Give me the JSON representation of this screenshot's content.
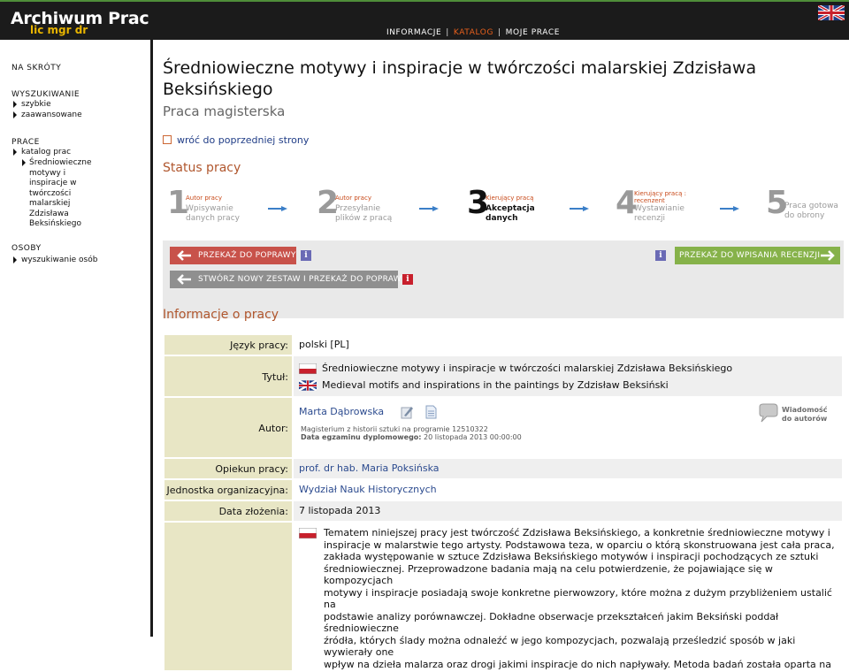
{
  "header": {
    "logo": "Archiwum Prac",
    "logo_sub": "lic mgr dr",
    "nav": [
      "INFORMACJE",
      "KATALOG",
      "MOJE PRACE"
    ],
    "nav_sep": "|",
    "active_nav": "KATALOG",
    "language_icon": "uk-flag-icon"
  },
  "sidebar": {
    "shortcuts": "NA SKRÓTY",
    "search": "WYSZUKIWANIE",
    "search_items": [
      "szybkie",
      "zaawansowane"
    ],
    "works": "PRACE",
    "works_items": [
      "katalog prac"
    ],
    "current_work_lines": [
      "Średniowieczne",
      "motywy i",
      "inspiracje w",
      "twórczości",
      "malarskiej",
      "Zdzisława",
      "Beksińskiego"
    ],
    "people": "OSOBY",
    "people_items": [
      "wyszukiwanie osób"
    ]
  },
  "work": {
    "title_line1": "Średniowieczne motywy i inspiracje w twórczości malarskiej Zdzisława",
    "title_line2": "Beksińskiego",
    "subtitle": "Praca magisterska",
    "back_link": "wróć do poprzedniej strony"
  },
  "status": {
    "heading": "Status pracy",
    "steps": [
      {
        "num": "1",
        "role": "Autor pracy",
        "line1": "Wpisywanie",
        "line2": "danych pracy",
        "active": false
      },
      {
        "num": "2",
        "role": "Autor pracy",
        "line1": "Przesyłanie",
        "line2": "plików z pracą",
        "active": false
      },
      {
        "num": "3",
        "role": "Kierujący pracą",
        "line1": "Akceptacja",
        "line2": "danych",
        "active": true
      },
      {
        "num": "4",
        "role": "Kierujący pracą :",
        "role2": "recenzent",
        "line1": "Wystawianie",
        "line2": "recenzji",
        "active": false
      },
      {
        "num": "5",
        "role": "",
        "line1": "Praca gotowa",
        "line2": "do obrony",
        "active": false
      }
    ],
    "btn_return": "PRZEKAŻ DO POPRAWY",
    "btn_review": "PRZEKAŻ DO WPISANIA RECENZJI",
    "btn_new_set": "STWÓRZ NOWY ZESTAW I PRZEKAŻ DO POPRAWY",
    "info_glyph": "i",
    "colors": {
      "red": "#c8524a",
      "green": "#86b24a",
      "gray": "#8f8f8f",
      "info_blue": "#6a6ab5"
    }
  },
  "info": {
    "heading": "Informacje o pracy",
    "language_label": "Język pracy:",
    "language_value": "polski [PL]",
    "title_label": "Tytuł:",
    "title_pl": "Średniowieczne motywy i inspiracje w twórczości malarskiej Zdzisława Beksińskiego",
    "title_en": "Medieval motifs and inspirations in the paintings by Zdzisław Beksiński",
    "author_label": "Autor:",
    "author_name": "Marta Dąbrowska",
    "author_program": "Magisterium z historii sztuki na programie 12510322",
    "exam_label": "Data egzaminu dyplomowego:",
    "exam_value": "20 listopada 2013 00:00:00",
    "message_label_1": "Wiadomość",
    "message_label_2": "do autorów",
    "supervisor_label": "Opiekun pracy:",
    "supervisor_value": "prof. dr hab. Maria Poksińska",
    "unit_label": "Jednostka organizacyjna:",
    "unit_value": "Wydział Nauk Historycznych",
    "date_label": "Data złożenia:",
    "date_value": "7 listopada 2013",
    "abstract_lines": [
      "Tematem niniejszej pracy jest twórczość Zdzisława Beksińskiego, a konkretnie średniowieczne motywy i",
      "inspiracje w malarstwie tego artysty. Podstawowa teza, w oparciu o którą skonstruowana jest cała praca,",
      "zakłada występowanie w sztuce Zdzisława Beksińskiego motywów i inspiracji pochodzących ze sztuki",
      "średniowiecznej. Przeprowadzone badania mają na celu potwierdzenie, że pojawiające się w kompozycjach",
      "motywy i inspiracje posiadają swoje konkretne pierwowzory, które można z dużym przybliżeniem ustalić na",
      "podstawie analizy porównawczej. Dokładne obserwacje przekształceń jakim Beksiński poddał średniowieczne",
      "źródła, których ślady można odnaleźć w jego kompozycjach, pozwalają prześledzić sposób w jaki wywierały one",
      "wpływ na dzieła malarza oraz drogi jakimi inspiracje do nich napływały. Metoda badań została oparta na"
    ]
  }
}
